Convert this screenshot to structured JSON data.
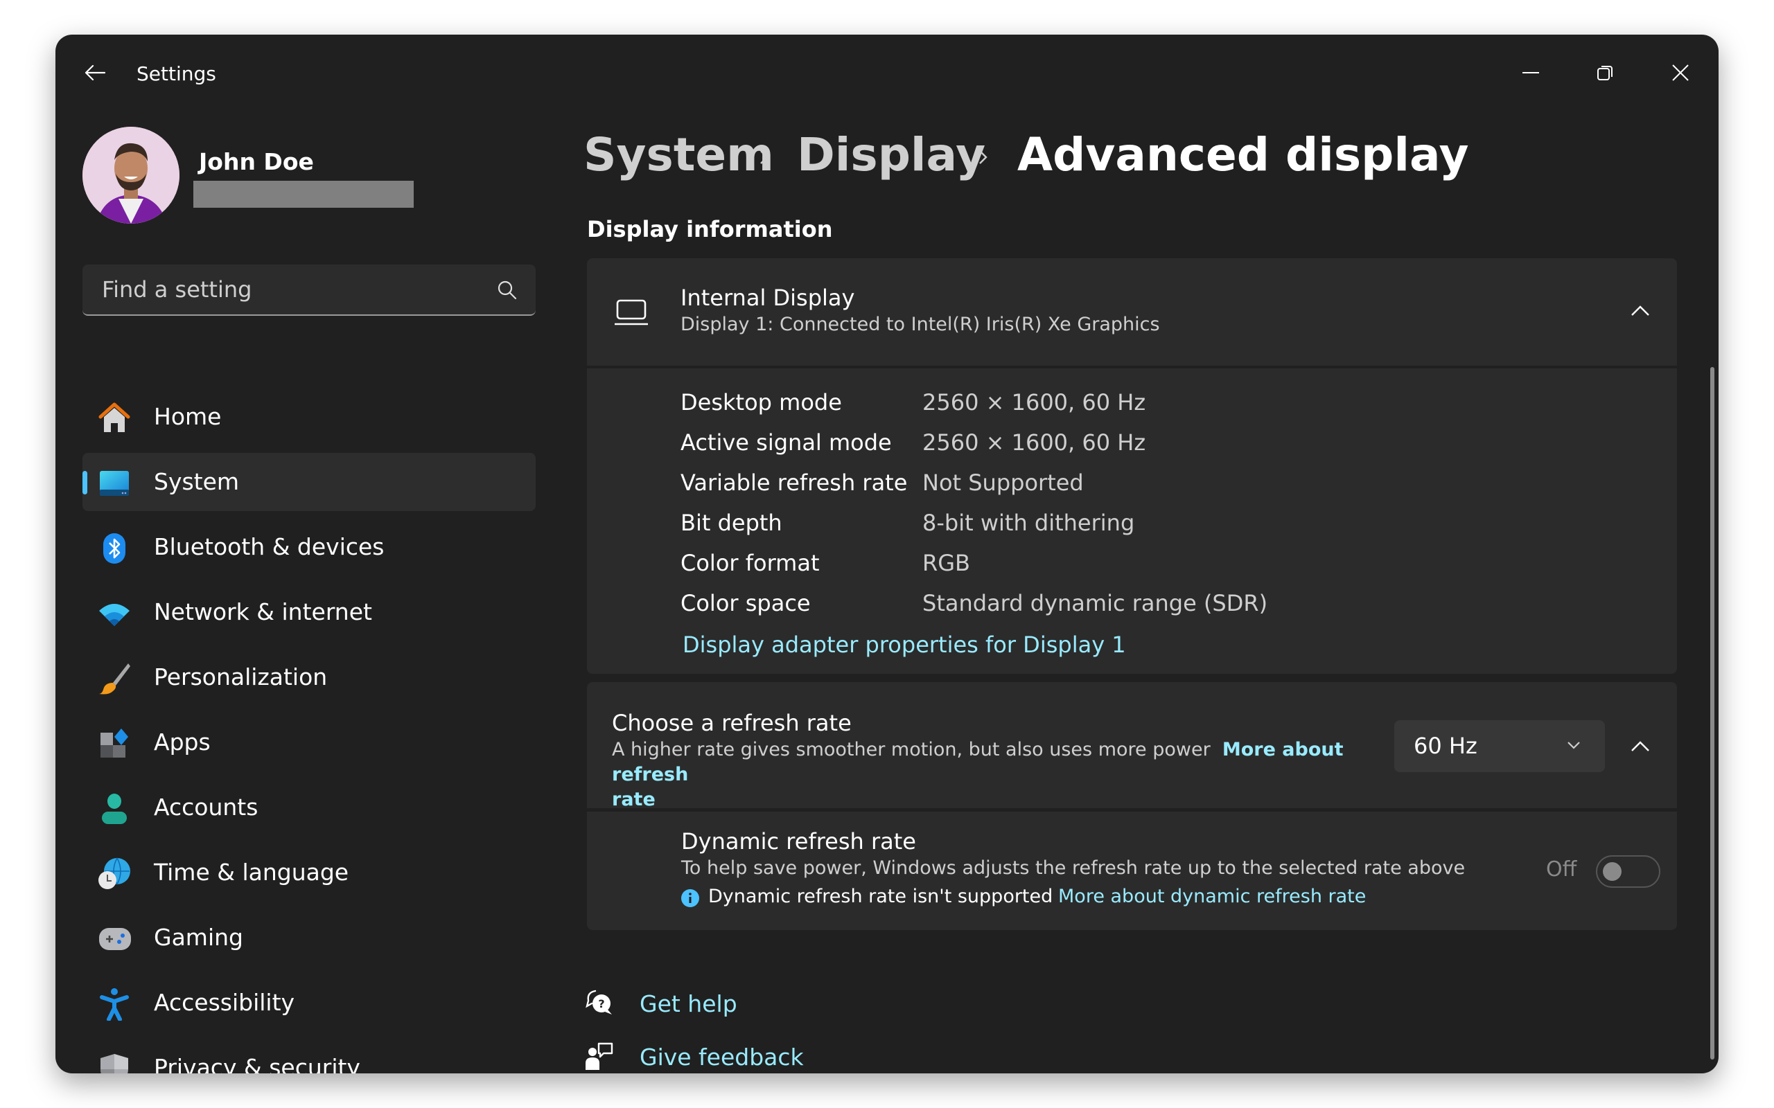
{
  "window": {
    "title": "Settings",
    "controls": {
      "minimize": "minimize",
      "restore": "restore",
      "close": "close"
    }
  },
  "user": {
    "name": "John Doe",
    "email_redacted": ""
  },
  "search": {
    "placeholder": "Find a setting",
    "value": ""
  },
  "sidebar": {
    "items": [
      {
        "label": "Home",
        "icon": "home-icon",
        "active": false
      },
      {
        "label": "System",
        "icon": "system-icon",
        "active": true
      },
      {
        "label": "Bluetooth & devices",
        "icon": "bluetooth-icon",
        "active": false
      },
      {
        "label": "Network & internet",
        "icon": "wifi-icon",
        "active": false
      },
      {
        "label": "Personalization",
        "icon": "brush-icon",
        "active": false
      },
      {
        "label": "Apps",
        "icon": "apps-icon",
        "active": false
      },
      {
        "label": "Accounts",
        "icon": "account-icon",
        "active": false
      },
      {
        "label": "Time & language",
        "icon": "time-language-icon",
        "active": false
      },
      {
        "label": "Gaming",
        "icon": "gamepad-icon",
        "active": false
      },
      {
        "label": "Accessibility",
        "icon": "accessibility-icon",
        "active": false
      },
      {
        "label": "Privacy & security",
        "icon": "shield-icon",
        "active": false
      }
    ]
  },
  "breadcrumb": {
    "items": [
      "System",
      "Display",
      "Advanced display"
    ],
    "separator": "›"
  },
  "display_info": {
    "section_title": "Display information",
    "display_name": "Internal Display",
    "display_subtitle": "Display 1: Connected to Intel(R) Iris(R) Xe Graphics",
    "expanded": true,
    "rows": [
      {
        "label": "Desktop mode",
        "value": "2560 × 1600, 60 Hz"
      },
      {
        "label": "Active signal mode",
        "value": "2560 × 1600, 60 Hz"
      },
      {
        "label": "Variable refresh rate",
        "value": "Not Supported"
      },
      {
        "label": "Bit depth",
        "value": "8-bit with dithering"
      },
      {
        "label": "Color format",
        "value": "RGB"
      },
      {
        "label": "Color space",
        "value": "Standard dynamic range (SDR)"
      }
    ],
    "adapter_link": "Display adapter properties for Display 1"
  },
  "refresh_rate": {
    "title": "Choose a refresh rate",
    "description": "A higher rate gives smoother motion, but also uses more power",
    "link_line1": "More about refresh",
    "link_line2": "rate",
    "selected": "60 Hz",
    "expanded": true
  },
  "dynamic_refresh": {
    "title": "Dynamic refresh rate",
    "description": "To help save power, Windows adjusts the refresh rate up to the selected rate above",
    "notice": "Dynamic refresh rate isn't supported",
    "link": "More about dynamic refresh rate",
    "toggle_label": "Off",
    "toggle_on": false,
    "toggle_disabled": true
  },
  "footer": {
    "get_help": "Get help",
    "give_feedback": "Give feedback"
  },
  "colors": {
    "accent": "#4cc2ff",
    "link": "#99ebff",
    "window_bg": "#202020",
    "card_bg": "#2b2b2b"
  }
}
